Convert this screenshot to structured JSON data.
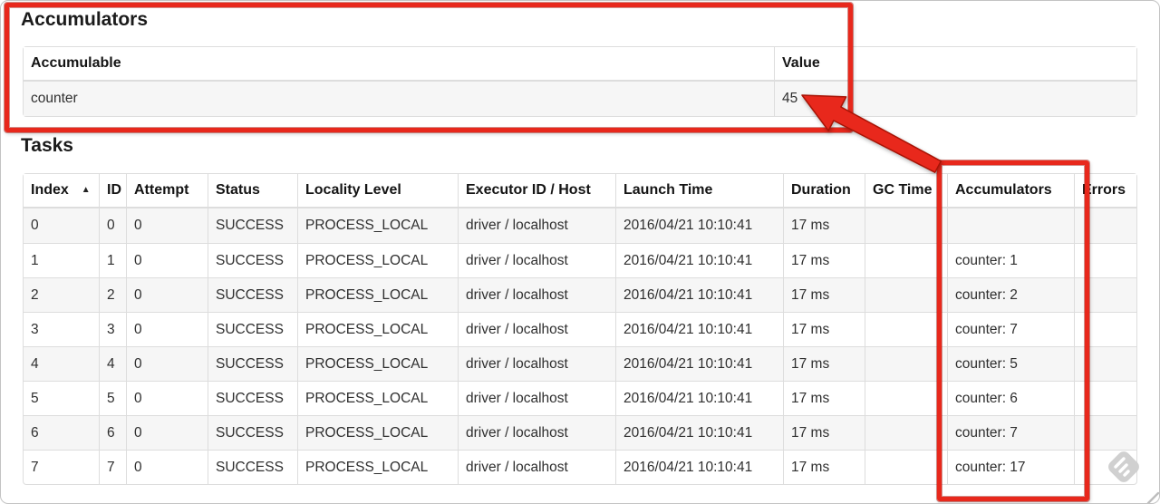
{
  "accumulators_section": {
    "title": "Accumulators",
    "table": {
      "headers": [
        "Accumulable",
        "Value"
      ],
      "rows": [
        {
          "accumulable": "counter",
          "value": "45"
        }
      ]
    }
  },
  "tasks_section": {
    "title": "Tasks",
    "table": {
      "headers": [
        "Index",
        "ID",
        "Attempt",
        "Status",
        "Locality Level",
        "Executor ID / Host",
        "Launch Time",
        "Duration",
        "GC Time",
        "Accumulators",
        "Errors"
      ],
      "sort_indicator": "▲",
      "rows": [
        {
          "index": "0",
          "id": "0",
          "attempt": "0",
          "status": "SUCCESS",
          "locality_level": "PROCESS_LOCAL",
          "executor_id_host": "driver / localhost",
          "launch_time": "2016/04/21 10:10:41",
          "duration": "17 ms",
          "gc_time": "",
          "accumulators": "",
          "errors": ""
        },
        {
          "index": "1",
          "id": "1",
          "attempt": "0",
          "status": "SUCCESS",
          "locality_level": "PROCESS_LOCAL",
          "executor_id_host": "driver / localhost",
          "launch_time": "2016/04/21 10:10:41",
          "duration": "17 ms",
          "gc_time": "",
          "accumulators": "counter: 1",
          "errors": ""
        },
        {
          "index": "2",
          "id": "2",
          "attempt": "0",
          "status": "SUCCESS",
          "locality_level": "PROCESS_LOCAL",
          "executor_id_host": "driver / localhost",
          "launch_time": "2016/04/21 10:10:41",
          "duration": "17 ms",
          "gc_time": "",
          "accumulators": "counter: 2",
          "errors": ""
        },
        {
          "index": "3",
          "id": "3",
          "attempt": "0",
          "status": "SUCCESS",
          "locality_level": "PROCESS_LOCAL",
          "executor_id_host": "driver / localhost",
          "launch_time": "2016/04/21 10:10:41",
          "duration": "17 ms",
          "gc_time": "",
          "accumulators": "counter: 7",
          "errors": ""
        },
        {
          "index": "4",
          "id": "4",
          "attempt": "0",
          "status": "SUCCESS",
          "locality_level": "PROCESS_LOCAL",
          "executor_id_host": "driver / localhost",
          "launch_time": "2016/04/21 10:10:41",
          "duration": "17 ms",
          "gc_time": "",
          "accumulators": "counter: 5",
          "errors": ""
        },
        {
          "index": "5",
          "id": "5",
          "attempt": "0",
          "status": "SUCCESS",
          "locality_level": "PROCESS_LOCAL",
          "executor_id_host": "driver / localhost",
          "launch_time": "2016/04/21 10:10:41",
          "duration": "17 ms",
          "gc_time": "",
          "accumulators": "counter: 6",
          "errors": ""
        },
        {
          "index": "6",
          "id": "6",
          "attempt": "0",
          "status": "SUCCESS",
          "locality_level": "PROCESS_LOCAL",
          "executor_id_host": "driver / localhost",
          "launch_time": "2016/04/21 10:10:41",
          "duration": "17 ms",
          "gc_time": "",
          "accumulators": "counter: 7",
          "errors": ""
        },
        {
          "index": "7",
          "id": "7",
          "attempt": "0",
          "status": "SUCCESS",
          "locality_level": "PROCESS_LOCAL",
          "executor_id_host": "driver / localhost",
          "launch_time": "2016/04/21 10:10:41",
          "duration": "17 ms",
          "gc_time": "",
          "accumulators": "counter: 17",
          "errors": ""
        }
      ]
    }
  },
  "annotations": {
    "accent_color": "#e8281c",
    "boxes": [
      {
        "target": "accumulators-section"
      },
      {
        "target": "accumulators-column"
      }
    ],
    "arrow": {
      "from": "accumulators-column-box",
      "points_to": "accumulator-value-45"
    }
  },
  "watermark": {
    "icon": "feedly-diamond-icon",
    "color": "#d0d0d0"
  }
}
